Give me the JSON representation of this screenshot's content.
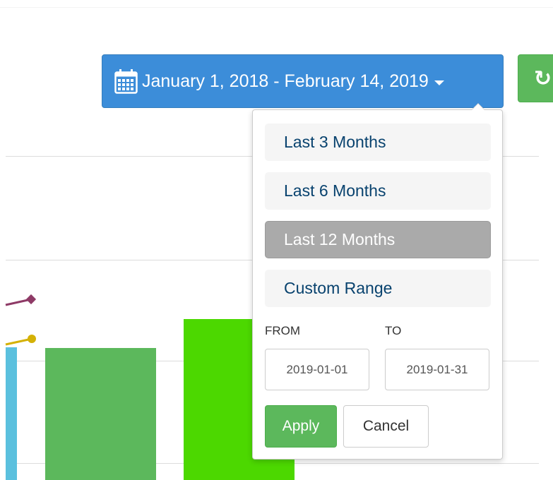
{
  "date_range": {
    "label": "January 1, 2018 - February 14, 2019",
    "calendar_icon": "calendar-icon",
    "caret_icon": "caret-down-icon",
    "color": "#3c8dd9"
  },
  "refresh": {
    "icon": "refresh-icon",
    "glyph": "↻",
    "color": "#5cb85c"
  },
  "dropdown": {
    "ranges": [
      {
        "label": "Last 3 Months",
        "active": false
      },
      {
        "label": "Last 6 Months",
        "active": false
      },
      {
        "label": "Last 12 Months",
        "active": true
      },
      {
        "label": "Custom Range",
        "active": false
      }
    ],
    "from_label": "FROM",
    "to_label": "TO",
    "from_value": "2019-01-01",
    "to_value": "2019-01-31",
    "apply_label": "Apply",
    "cancel_label": "Cancel"
  },
  "background_chart": {
    "bar_colors": [
      "#5bc0de",
      "#5cb85c",
      "#4cd800"
    ],
    "line_colors": [
      "#8e3a66",
      "#d4b106"
    ]
  }
}
